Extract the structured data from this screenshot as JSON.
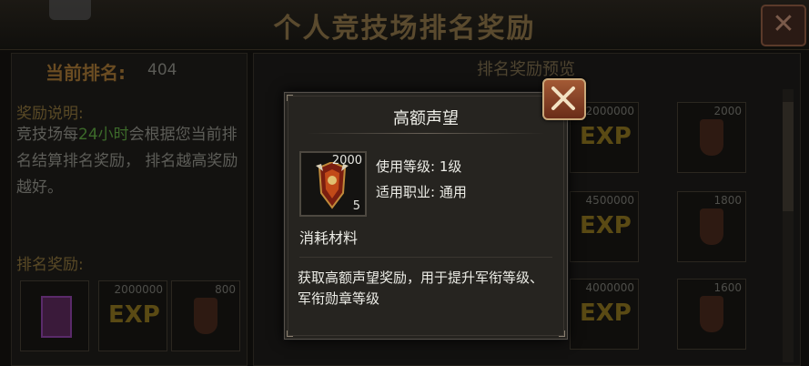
{
  "window": {
    "title": "个人竞技场排名奖励",
    "close_icon": "close-icon"
  },
  "left": {
    "rank_label": "当前排名:",
    "rank_value": "404",
    "desc_title": "奖励说明:",
    "desc_before": "竞技场每",
    "desc_highlight": "24小时",
    "desc_after": "会根据您当前排名结算排名奖励， 排名越高奖励越好。",
    "reward_title": "排名奖励:",
    "rewards": [
      {
        "icon": "gem-icon",
        "amount": ""
      },
      {
        "icon": "exp-icon",
        "amount": "2000000"
      },
      {
        "icon": "prestige-badge-icon",
        "amount": "800"
      }
    ]
  },
  "right": {
    "header": "排名奖励预览",
    "amounts": [
      "2000000",
      "2000",
      "4500000",
      "1800",
      "4000000",
      "1600"
    ]
  },
  "popup": {
    "title": "高额声望",
    "item_amount": "2000",
    "item_count": "5",
    "level_req": "使用等级: 1级",
    "class_req": "适用职业: 通用",
    "category": "消耗材料",
    "description": "获取高额声望奖励，用于提升军衔等级、军衔勋章等级",
    "colors": {
      "accent": "#a35a35",
      "text": "#ecece6"
    }
  }
}
